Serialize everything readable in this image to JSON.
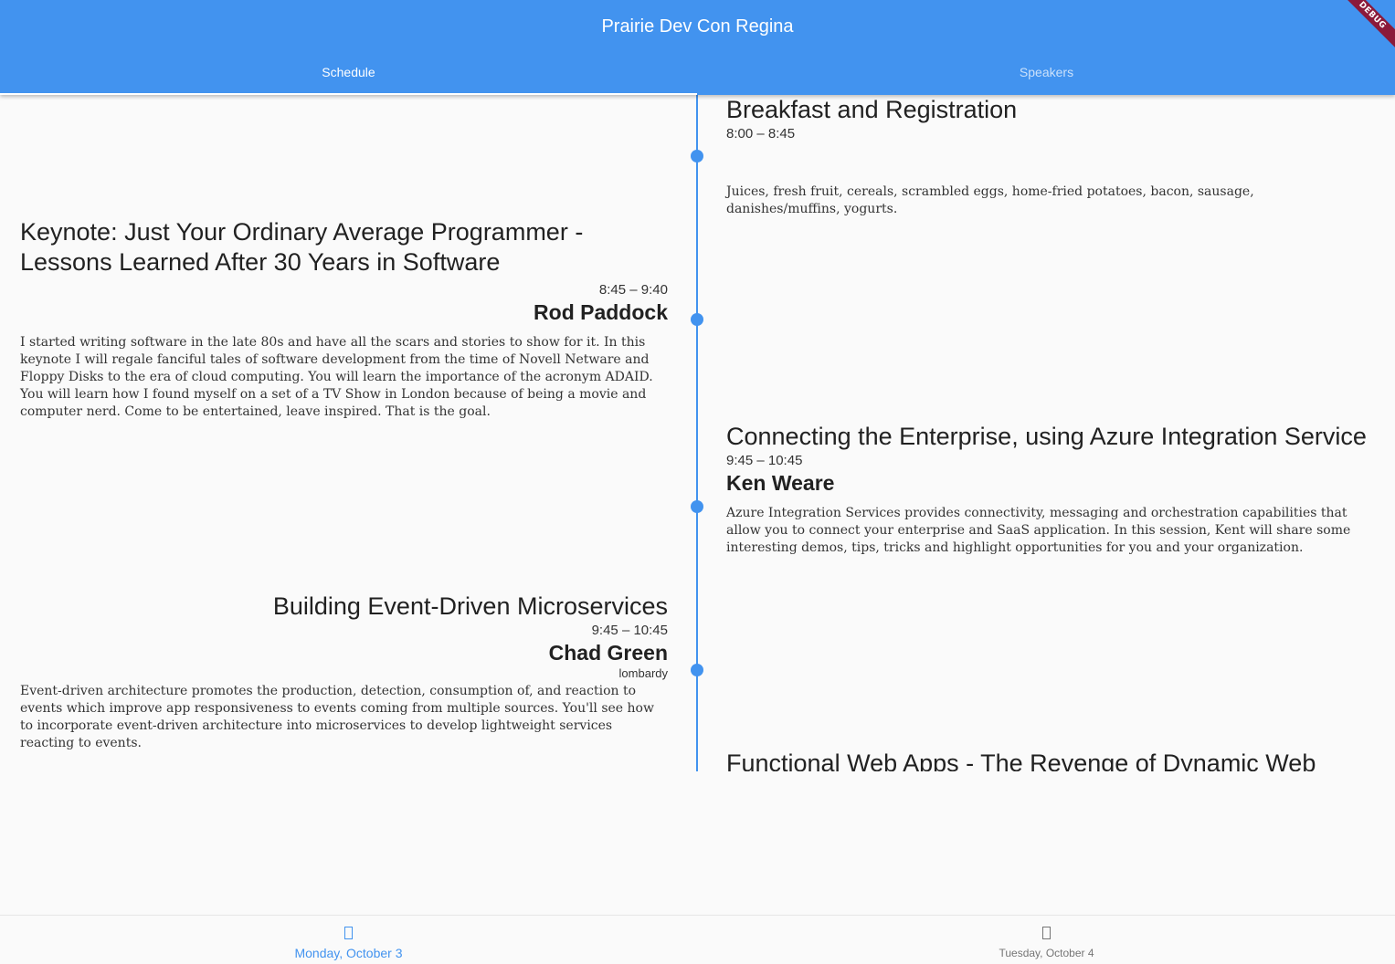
{
  "app": {
    "title": "Prairie Dev Con Regina",
    "debug_banner": "DEBUG",
    "accent_color": "#4293ef"
  },
  "tabs": [
    {
      "label": "Schedule",
      "selected": true
    },
    {
      "label": "Speakers",
      "selected": false
    }
  ],
  "sessions": [
    {
      "title": "Breakfast and Registration",
      "time": "8:00 – 8:45",
      "speaker": "",
      "room": "",
      "description": "Juices, fresh fruit, cereals, scrambled eggs, home-fried potatoes, bacon, sausage, danishes/muffins, yogurts."
    },
    {
      "title": "Keynote: Just Your Ordinary Average Programmer - Lessons Learned After 30 Years in Software",
      "time": "8:45 – 9:40",
      "speaker": "Rod Paddock",
      "room": "",
      "description": "I started writing software in the late 80s and have all the scars and stories to show for it. In this keynote I will regale fanciful tales of software development from the time of Novell Netware and Floppy Disks to the era of cloud computing. You will learn the importance of the acronym ADAID. You will learn how I found myself on a set of a TV Show in London because of being a movie and computer nerd. Come to be entertained, leave inspired. That is the goal."
    },
    {
      "title": "Connecting the Enterprise, using Azure Integration Service",
      "time": "9:45 – 10:45",
      "speaker": "Ken Weare",
      "room": "",
      "description": "Azure Integration Services provides connectivity, messaging and orchestration capabilities that allow you to connect your enterprise and SaaS application. In this session, Kent will share some interesting demos, tips, tricks and highlight opportunities for you and your organization."
    },
    {
      "title": "Building Event-Driven Microservices",
      "time": "9:45 – 10:45",
      "speaker": "Chad Green",
      "room": "lombardy",
      "description": "Event-driven architecture promotes the production, detection, consumption of, and reaction to events which improve app responsiveness to events coming from multiple sources. You'll see how to incorporate event-driven architecture into microservices to develop lightweight services reacting to events."
    },
    {
      "title": "Functional Web Apps - The Revenge of Dynamic Web",
      "time": "",
      "speaker": "",
      "room": "",
      "description": ""
    }
  ],
  "bottom_nav": [
    {
      "label": "Monday, October 3",
      "icon": "calendar-icon",
      "selected": true
    },
    {
      "label": "Tuesday, October 4",
      "icon": "calendar-icon",
      "selected": false
    }
  ]
}
